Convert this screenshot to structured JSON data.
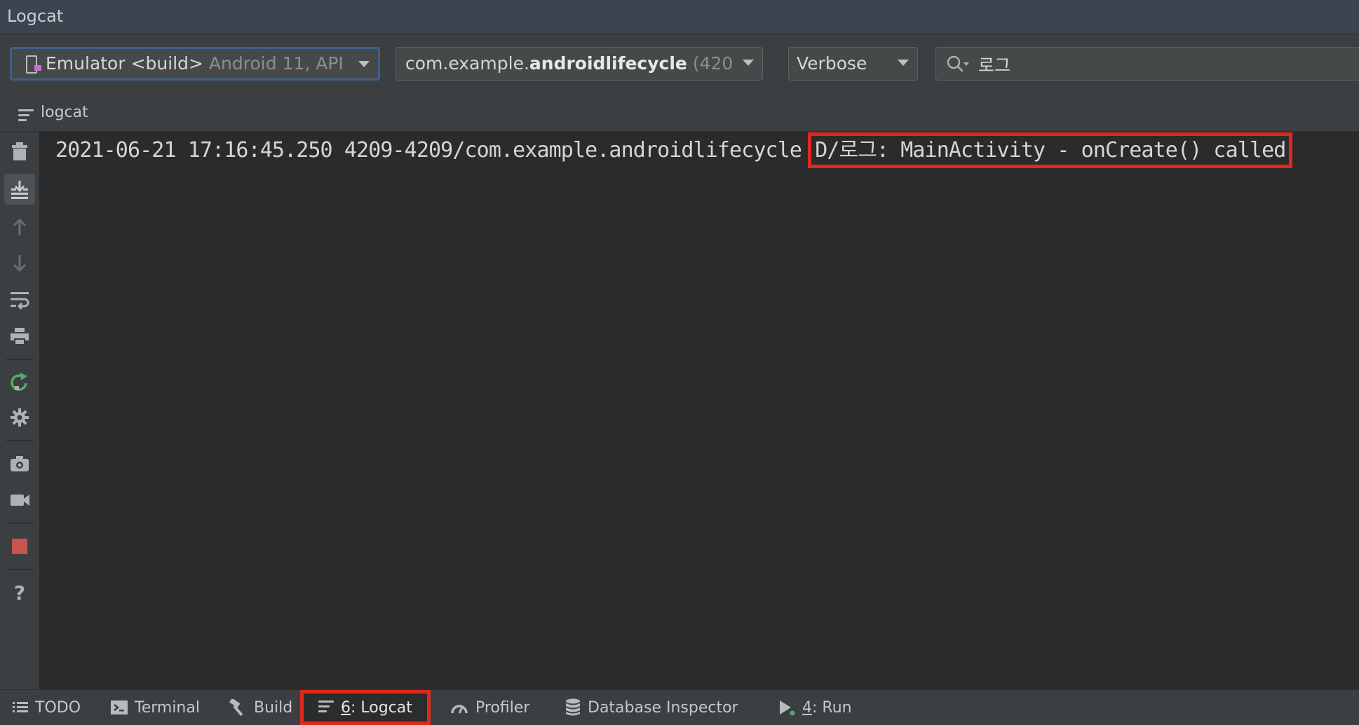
{
  "window": {
    "title": "Logcat"
  },
  "toolbar": {
    "device_selector": {
      "name": "Emulator <build>",
      "detail": "Android 11, API"
    },
    "process_selector": {
      "prefix": "com.example.",
      "bold": "androidlifecycle",
      "detail": "(420"
    },
    "level_selector": {
      "value": "Verbose"
    },
    "search": {
      "value": "로그"
    }
  },
  "subtab": {
    "label": "logcat"
  },
  "sidebar": {
    "icons": [
      "trash-icon",
      "scroll-to-end-icon",
      "arrow-up-icon",
      "arrow-down-icon",
      "soft-wrap-icon",
      "print-icon",
      "restart-icon",
      "gear-icon",
      "camera-icon",
      "video-icon",
      "stop-icon",
      "help-icon"
    ]
  },
  "log": {
    "lines": [
      {
        "prefix": "2021-06-21 17:16:45.250 4209-4209/com.example.androidlifecycle",
        "message": "D/로그: MainActivity - onCreate() called"
      }
    ]
  },
  "statusbar": {
    "tabs": [
      {
        "label": "TODO"
      },
      {
        "label": "Terminal"
      },
      {
        "label": "Build"
      },
      {
        "mnemonic": "6",
        "label": ": Logcat"
      },
      {
        "label": "Profiler"
      },
      {
        "label": "Database Inspector"
      },
      {
        "mnemonic": "4",
        "label": ": Run"
      }
    ]
  },
  "colors": {
    "highlight": "#e0291d",
    "background": "#2b2b2b",
    "panel": "#3c3f41",
    "title_bar": "#3c4450",
    "restart_icon": "#59a869",
    "stop_icon": "#c75450"
  }
}
